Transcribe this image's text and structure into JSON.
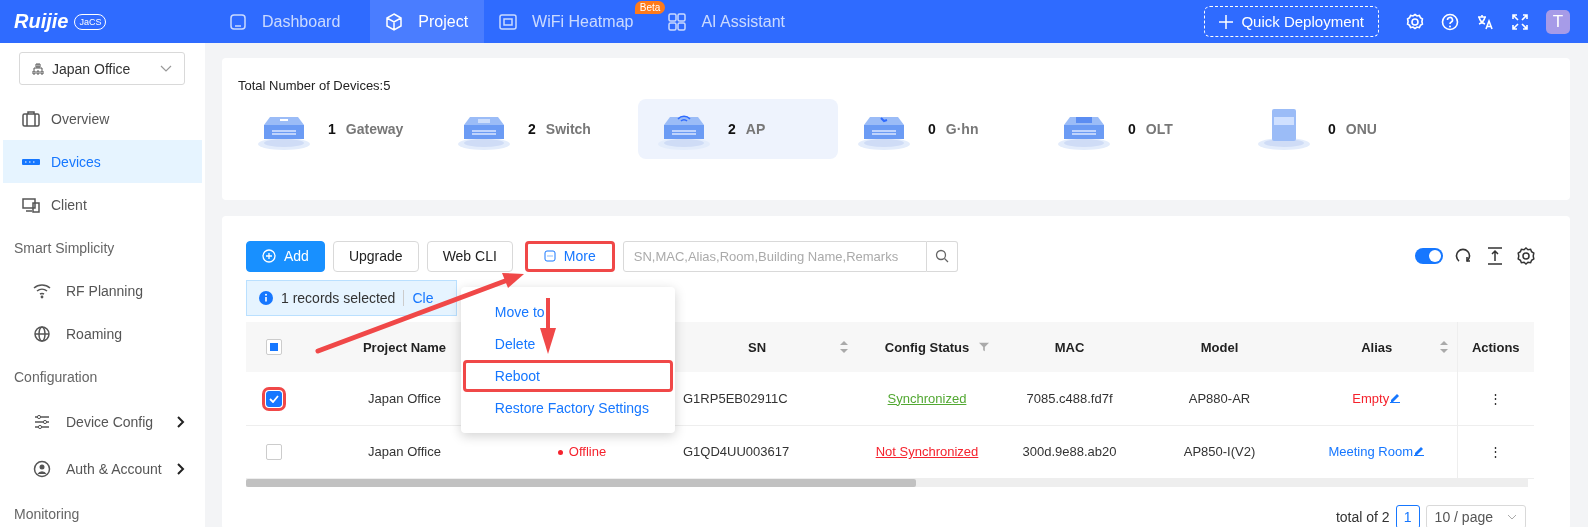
{
  "header": {
    "logo": "Ruijie",
    "logo_badge": "JaCS",
    "nav": [
      {
        "label": "Dashboard",
        "selected": false
      },
      {
        "label": "Project",
        "selected": true
      },
      {
        "label": "WiFi Heatmap",
        "selected": false,
        "badge": "Beta"
      },
      {
        "label": "AI Assistant",
        "selected": false
      }
    ],
    "quick_deployment": "Quick Deployment",
    "avatar": "T"
  },
  "sidebar": {
    "project_selector": "Japan Office",
    "items": [
      {
        "kind": "item",
        "label": "Overview",
        "selected": false
      },
      {
        "kind": "item",
        "label": "Devices",
        "selected": true
      },
      {
        "kind": "item",
        "label": "Client",
        "selected": false
      },
      {
        "kind": "section",
        "label": "Smart Simplicity"
      },
      {
        "kind": "subitem",
        "label": "RF Planning",
        "selected": false,
        "expandable": false
      },
      {
        "kind": "subitem",
        "label": "Roaming",
        "selected": false,
        "expandable": false
      },
      {
        "kind": "section",
        "label": "Configuration"
      },
      {
        "kind": "subitem",
        "label": "Device Config",
        "selected": false,
        "expandable": true
      },
      {
        "kind": "subitem",
        "label": "Auth & Account",
        "selected": false,
        "expandable": true
      },
      {
        "kind": "section",
        "label": "Monitoring"
      }
    ]
  },
  "summary": {
    "total": "Total Number of Devices:5",
    "device_types": [
      {
        "count": "1",
        "label": "Gateway",
        "selected": false
      },
      {
        "count": "2",
        "label": "Switch",
        "selected": false
      },
      {
        "count": "2",
        "label": "AP",
        "selected": true
      },
      {
        "count": "0",
        "label": "G·hn",
        "selected": false
      },
      {
        "count": "0",
        "label": "OLT",
        "selected": false
      },
      {
        "count": "0",
        "label": "ONU",
        "selected": false
      }
    ]
  },
  "toolbar": {
    "buttons": [
      {
        "kind": "primary",
        "label": "Add",
        "annotated": false
      },
      {
        "kind": "default",
        "label": "Upgrade",
        "annotated": false
      },
      {
        "kind": "default",
        "label": "Web CLI",
        "annotated": false
      },
      {
        "kind": "more",
        "label": "More",
        "annotated": true
      }
    ],
    "search": {
      "placeholder": "SN,MAC,Alias,Room,Building Name,Remarks"
    },
    "toggle": {
      "on": true
    }
  },
  "selection_bar": {
    "text": "1 records selected",
    "link": "Cle"
  },
  "dropdown": {
    "items": [
      {
        "label": "Move to",
        "annotated": false
      },
      {
        "label": "Delete",
        "annotated": false
      },
      {
        "label": "Reboot",
        "annotated": true
      },
      {
        "label": "Restore Factory Settings",
        "annotated": false
      }
    ]
  },
  "table": {
    "header_checkbox": {
      "indeterminate": true
    },
    "columns": [
      {
        "kind": "text",
        "label": "Project Name"
      },
      {
        "kind": "status"
      },
      {
        "kind": "link",
        "label": "SN",
        "sortable": true
      },
      {
        "kind": "config",
        "label": "Config Status",
        "filter": true
      },
      {
        "kind": "text",
        "label": "MAC"
      },
      {
        "kind": "text",
        "label": "Model"
      },
      {
        "kind": "alias",
        "label": "Alias",
        "sortable": true
      },
      {
        "kind": "actions",
        "label": "Actions"
      }
    ],
    "rows": [
      {
        "checked": true,
        "annotated": true,
        "cells": [
          {
            "text": "Japan Office"
          },
          null,
          {
            "text": "G1RP5EB02911C"
          },
          {
            "text": "Synchronized",
            "synced": true
          },
          {
            "text": "7085.c488.fd7f"
          },
          {
            "text": "AP880-AR"
          },
          {
            "text": "Empty",
            "empty": true
          },
          {
            "text": "⋮"
          }
        ]
      },
      {
        "checked": false,
        "annotated": false,
        "cells": [
          {
            "text": "Japan Office"
          },
          {
            "text": "Offline",
            "online": false
          },
          {
            "text": "G1QD4UU003617"
          },
          {
            "text": "Not Synchronized",
            "synced": false
          },
          {
            "text": "300d.9e88.ab20"
          },
          {
            "text": "AP850-I(V2)"
          },
          {
            "text": "Meeting Room",
            "empty": false
          },
          {
            "text": "⋮"
          }
        ]
      }
    ]
  },
  "pagination": {
    "total": "total of 2",
    "pages": [
      {
        "label": "1",
        "selected": true
      }
    ],
    "page_size": "10 / page"
  }
}
